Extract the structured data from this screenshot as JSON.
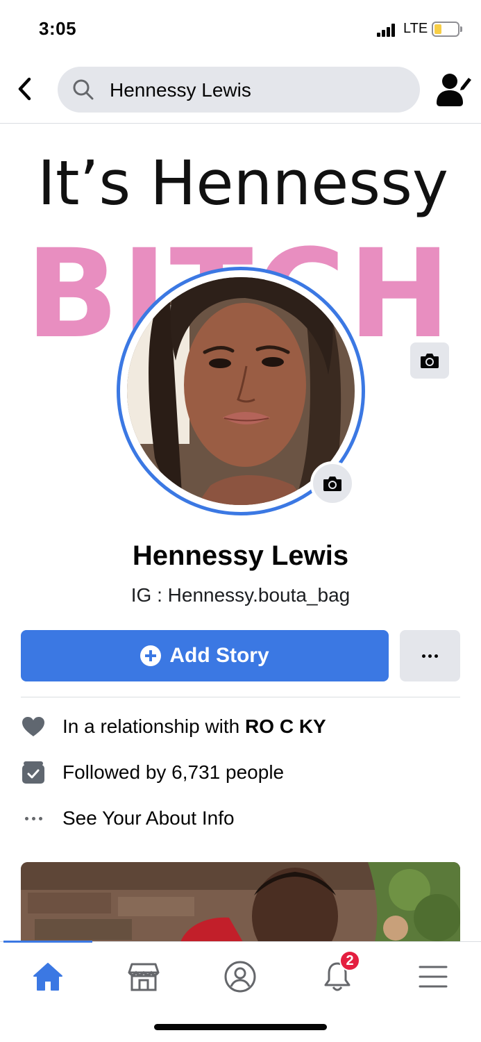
{
  "status": {
    "time": "3:05",
    "network": "LTE",
    "battery_level": 0.3,
    "icons": [
      "signal-icon",
      "battery-icon"
    ]
  },
  "nav": {
    "search_value": "Hennessy Lewis",
    "icons": [
      "back-chevron-icon",
      "search-icon",
      "user-edit-icon"
    ]
  },
  "cover": {
    "line1": "It’s Hennessy",
    "line2": "BITCH"
  },
  "profile": {
    "name": "Hennessy Lewis",
    "bio": "IG : Hennessy.bouta_bag"
  },
  "actions": {
    "add_story_label": "Add Story",
    "more_icon": "more-dots-icon"
  },
  "info": {
    "relationship_prefix": "In a relationship with ",
    "relationship_partner": "RO C KY",
    "followers": "Followed by 6,731 people",
    "about": "See Your About Info"
  },
  "tabs": {
    "items": [
      "home-icon",
      "marketplace-icon",
      "profile-icon",
      "notifications-icon",
      "menu-icon"
    ],
    "active": "home",
    "notification_count": "2"
  },
  "colors": {
    "accent": "#3b78e3",
    "badge": "#e41e3f",
    "cover_pink": "#e88ec0"
  }
}
